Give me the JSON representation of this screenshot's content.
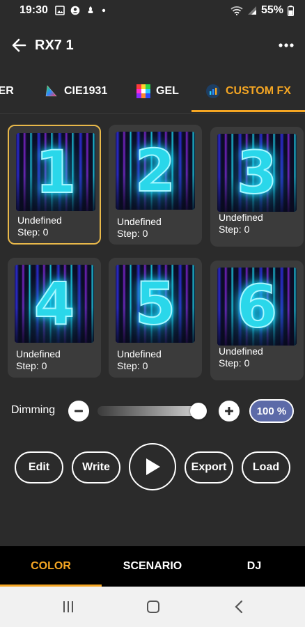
{
  "status_bar": {
    "time": "19:30",
    "battery": "55%"
  },
  "app_bar": {
    "title": "RX7 1",
    "back_icon": "arrow-left-icon",
    "menu_icon": "more-horizontal-icon"
  },
  "tabs": [
    {
      "label": "KER",
      "icon": "",
      "active": false
    },
    {
      "label": "CIE1931",
      "icon": "color-triangle-icon",
      "active": false
    },
    {
      "label": "GEL",
      "icon": "color-grid-icon",
      "active": false
    },
    {
      "label": "CUSTOM FX",
      "icon": "chart-icon",
      "active": true
    }
  ],
  "fx_slots": [
    {
      "number": "1",
      "name": "Undefined",
      "step": "Step: 0",
      "selected": true
    },
    {
      "number": "2",
      "name": "Undefined",
      "step": "Step: 0",
      "selected": false
    },
    {
      "number": "3",
      "name": "Undefined",
      "step": "Step: 0",
      "selected": false
    },
    {
      "number": "4",
      "name": "Undefined",
      "step": "Step: 0",
      "selected": false
    },
    {
      "number": "5",
      "name": "Undefined",
      "step": "Step: 0",
      "selected": false
    },
    {
      "number": "6",
      "name": "Undefined",
      "step": "Step: 0",
      "selected": false
    }
  ],
  "dimming": {
    "label": "Dimming",
    "value_text": "100 %",
    "level": 1.0
  },
  "controls": {
    "edit": "Edit",
    "write": "Write",
    "export": "Export",
    "load": "Load"
  },
  "bottom_nav": [
    {
      "label": "COLOR",
      "active": true
    },
    {
      "label": "SCENARIO",
      "active": false
    },
    {
      "label": "DJ",
      "active": false
    }
  ],
  "colors": {
    "accent": "#f5a623",
    "selected_border": "#e8b84a",
    "percent_badge": "#5c6aa8"
  }
}
